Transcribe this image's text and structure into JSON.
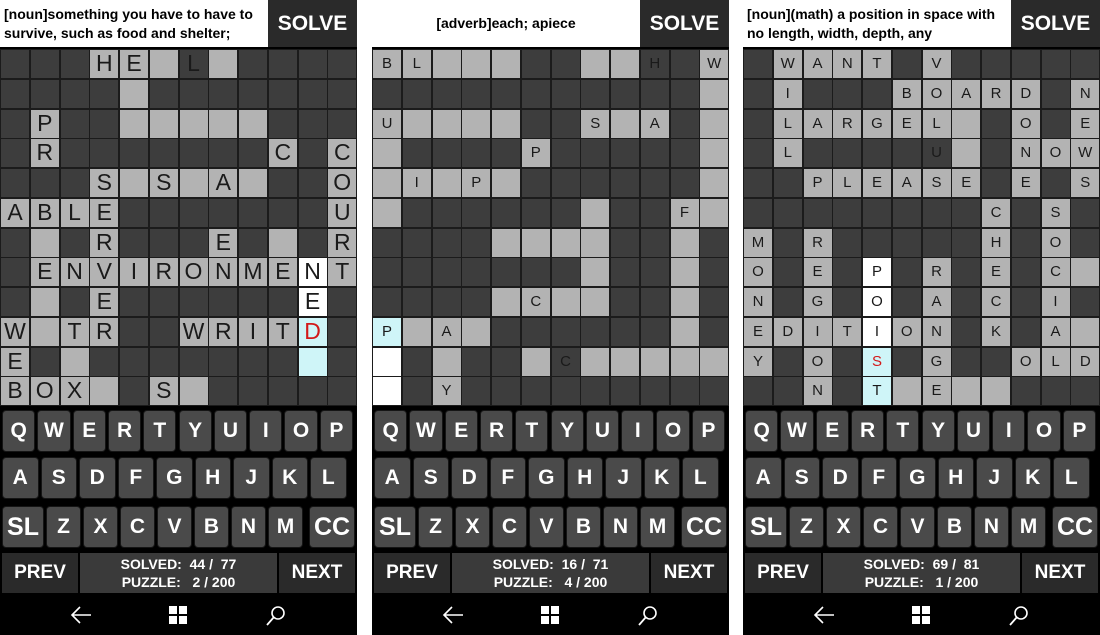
{
  "screens": [
    {
      "clue": "[noun]something you have to have to survive, such as food and shelter;",
      "solve_label": "SOLVE",
      "rows": [
        "DDDLLLDLDDDD",
        "DDDDLDDDDDDD",
        "DLDDLLLLLDDD",
        "DLDDDDDDDLDL",
        "DDDLLLLLLDDL",
        "LLLLDDDDDDDL",
        "DLDLDDDLDLDL",
        "DLLLLLLLLLWL",
        "DLDLDDDDDDWD",
        "LLLLDDLLLLCD",
        "LDLDDDDDDDCD",
        "LLLLDLLDDDDD"
      ],
      "letters": [
        {
          "r": 0,
          "c": 3,
          "t": "H"
        },
        {
          "r": 0,
          "c": 4,
          "t": "E"
        },
        {
          "r": 0,
          "c": 6,
          "t": "L"
        },
        {
          "r": 2,
          "c": 1,
          "t": "P"
        },
        {
          "r": 3,
          "c": 1,
          "t": "R"
        },
        {
          "r": 3,
          "c": 9,
          "t": "C"
        },
        {
          "r": 3,
          "c": 11,
          "t": "C"
        },
        {
          "r": 4,
          "c": 3,
          "t": "S"
        },
        {
          "r": 4,
          "c": 5,
          "t": "S"
        },
        {
          "r": 4,
          "c": 7,
          "t": "A"
        },
        {
          "r": 4,
          "c": 11,
          "t": "O"
        },
        {
          "r": 5,
          "c": 0,
          "t": "A"
        },
        {
          "r": 5,
          "c": 1,
          "t": "B"
        },
        {
          "r": 5,
          "c": 2,
          "t": "L"
        },
        {
          "r": 5,
          "c": 3,
          "t": "E"
        },
        {
          "r": 5,
          "c": 11,
          "t": "U"
        },
        {
          "r": 6,
          "c": 3,
          "t": "R"
        },
        {
          "r": 6,
          "c": 7,
          "t": "E"
        },
        {
          "r": 6,
          "c": 11,
          "t": "R"
        },
        {
          "r": 7,
          "c": 1,
          "t": "E"
        },
        {
          "r": 7,
          "c": 2,
          "t": "N"
        },
        {
          "r": 7,
          "c": 3,
          "t": "V"
        },
        {
          "r": 7,
          "c": 4,
          "t": "I"
        },
        {
          "r": 7,
          "c": 5,
          "t": "R"
        },
        {
          "r": 7,
          "c": 6,
          "t": "O"
        },
        {
          "r": 7,
          "c": 7,
          "t": "N"
        },
        {
          "r": 7,
          "c": 8,
          "t": "M"
        },
        {
          "r": 7,
          "c": 9,
          "t": "E"
        },
        {
          "r": 7,
          "c": 10,
          "t": "N"
        },
        {
          "r": 7,
          "c": 11,
          "t": "T"
        },
        {
          "r": 8,
          "c": 3,
          "t": "E"
        },
        {
          "r": 8,
          "c": 10,
          "t": "E"
        },
        {
          "r": 9,
          "c": 0,
          "t": "W"
        },
        {
          "r": 9,
          "c": 2,
          "t": "T"
        },
        {
          "r": 9,
          "c": 3,
          "t": "R"
        },
        {
          "r": 9,
          "c": 6,
          "t": "W"
        },
        {
          "r": 9,
          "c": 7,
          "t": "R"
        },
        {
          "r": 9,
          "c": 8,
          "t": "I"
        },
        {
          "r": 9,
          "c": 9,
          "t": "T"
        },
        {
          "r": 9,
          "c": 10,
          "t": "D",
          "red": true
        },
        {
          "r": 10,
          "c": 0,
          "t": "E"
        },
        {
          "r": 11,
          "c": 0,
          "t": "B"
        },
        {
          "r": 11,
          "c": 1,
          "t": "O"
        },
        {
          "r": 11,
          "c": 2,
          "t": "X"
        },
        {
          "r": 11,
          "c": 5,
          "t": "S"
        }
      ],
      "keys": [
        "Q",
        "W",
        "E",
        "R",
        "T",
        "Y",
        "U",
        "I",
        "O",
        "P",
        "A",
        "S",
        "D",
        "F",
        "G",
        "H",
        "J",
        "K",
        "L",
        "SL",
        "Z",
        "X",
        "C",
        "V",
        "B",
        "N",
        "M",
        "CC"
      ],
      "prev_label": "PREV",
      "next_label": "NEXT",
      "solved_line": "SOLVED:  44 /  77",
      "puzzle_line": "PUZZLE:   2 / 200"
    },
    {
      "clue": "[adverb]each; apiece",
      "solve_label": "SOLVE",
      "rows": [
        "LLLLLDDLLDDL",
        "DDDDDDDDDDDL",
        "LLLLLDDLLLDL",
        "LDDDDLDDDDDL",
        "LLLLLDDDDDDL",
        "LDDDDDDLDDLL",
        "DDDDLLLLDDLD",
        "DDDDDDDLDDLD",
        "DDDDLLLLDDLD",
        "CLLLDDDDDDLD",
        "WDLDDLDLLLLL",
        "WDLDDDDDDDDD"
      ],
      "letters": [
        {
          "r": 0,
          "c": 0,
          "t": "B"
        },
        {
          "r": 0,
          "c": 1,
          "t": "L"
        },
        {
          "r": 0,
          "c": 9,
          "t": "H"
        },
        {
          "r": 0,
          "c": 11,
          "t": "W"
        },
        {
          "r": 2,
          "c": 0,
          "t": "U"
        },
        {
          "r": 2,
          "c": 7,
          "t": "S"
        },
        {
          "r": 2,
          "c": 9,
          "t": "A"
        },
        {
          "r": 3,
          "c": 5,
          "t": "P"
        },
        {
          "r": 4,
          "c": 1,
          "t": "I"
        },
        {
          "r": 4,
          "c": 3,
          "t": "P"
        },
        {
          "r": 5,
          "c": 10,
          "t": "F"
        },
        {
          "r": 8,
          "c": 5,
          "t": "C"
        },
        {
          "r": 9,
          "c": 0,
          "t": "P"
        },
        {
          "r": 9,
          "c": 2,
          "t": "A"
        },
        {
          "r": 10,
          "c": 6,
          "t": "C"
        },
        {
          "r": 11,
          "c": 2,
          "t": "Y"
        }
      ],
      "keys": [
        "Q",
        "W",
        "E",
        "R",
        "T",
        "Y",
        "U",
        "I",
        "O",
        "P",
        "A",
        "S",
        "D",
        "F",
        "G",
        "H",
        "J",
        "K",
        "L",
        "SL",
        "Z",
        "X",
        "C",
        "V",
        "B",
        "N",
        "M",
        "CC"
      ],
      "prev_label": "PREV",
      "next_label": "NEXT",
      "solved_line": "SOLVED:  16 /  71",
      "puzzle_line": "PUZZLE:   4 / 200"
    },
    {
      "clue": "[noun](math) a position in space with no length, width, depth, any",
      "solve_label": "SOLVE",
      "rows": [
        "DLLLLDLDDDDD",
        "DLDDDLLLLLDL",
        "DLLLLLLLDLDL",
        "DLDDDDDLDLLL",
        "DDLLLLLLDLDL",
        "DDDDDDDDLDLD",
        "LDLDDDDDLDLD",
        "LDLDWDLDLDLL",
        "LDLDWDLDLDLD",
        "LLLLWLLDLDLL",
        "LDLDCDLDDLLL",
        "DDLDCLLLLDDD"
      ],
      "letters": [
        {
          "r": 0,
          "c": 1,
          "t": "W"
        },
        {
          "r": 0,
          "c": 2,
          "t": "A"
        },
        {
          "r": 0,
          "c": 3,
          "t": "N"
        },
        {
          "r": 0,
          "c": 4,
          "t": "T"
        },
        {
          "r": 0,
          "c": 6,
          "t": "V"
        },
        {
          "r": 1,
          "c": 1,
          "t": "I"
        },
        {
          "r": 1,
          "c": 5,
          "t": "B"
        },
        {
          "r": 1,
          "c": 6,
          "t": "O"
        },
        {
          "r": 1,
          "c": 7,
          "t": "A"
        },
        {
          "r": 1,
          "c": 8,
          "t": "R"
        },
        {
          "r": 1,
          "c": 9,
          "t": "D"
        },
        {
          "r": 1,
          "c": 11,
          "t": "N"
        },
        {
          "r": 2,
          "c": 1,
          "t": "L"
        },
        {
          "r": 2,
          "c": 2,
          "t": "A"
        },
        {
          "r": 2,
          "c": 3,
          "t": "R"
        },
        {
          "r": 2,
          "c": 4,
          "t": "G"
        },
        {
          "r": 2,
          "c": 5,
          "t": "E"
        },
        {
          "r": 2,
          "c": 6,
          "t": "L"
        },
        {
          "r": 2,
          "c": 9,
          "t": "O"
        },
        {
          "r": 2,
          "c": 11,
          "t": "E"
        },
        {
          "r": 3,
          "c": 1,
          "t": "L"
        },
        {
          "r": 3,
          "c": 6,
          "t": "U"
        },
        {
          "r": 3,
          "c": 9,
          "t": "N"
        },
        {
          "r": 3,
          "c": 10,
          "t": "O"
        },
        {
          "r": 3,
          "c": 11,
          "t": "W"
        },
        {
          "r": 4,
          "c": 2,
          "t": "P"
        },
        {
          "r": 4,
          "c": 3,
          "t": "L"
        },
        {
          "r": 4,
          "c": 4,
          "t": "E"
        },
        {
          "r": 4,
          "c": 5,
          "t": "A"
        },
        {
          "r": 4,
          "c": 6,
          "t": "S"
        },
        {
          "r": 4,
          "c": 7,
          "t": "E"
        },
        {
          "r": 4,
          "c": 9,
          "t": "E"
        },
        {
          "r": 4,
          "c": 11,
          "t": "S"
        },
        {
          "r": 5,
          "c": 8,
          "t": "C"
        },
        {
          "r": 5,
          "c": 10,
          "t": "S"
        },
        {
          "r": 6,
          "c": 0,
          "t": "M"
        },
        {
          "r": 6,
          "c": 2,
          "t": "R"
        },
        {
          "r": 6,
          "c": 8,
          "t": "H"
        },
        {
          "r": 6,
          "c": 10,
          "t": "O"
        },
        {
          "r": 7,
          "c": 0,
          "t": "O"
        },
        {
          "r": 7,
          "c": 2,
          "t": "E"
        },
        {
          "r": 7,
          "c": 4,
          "t": "P"
        },
        {
          "r": 7,
          "c": 6,
          "t": "R"
        },
        {
          "r": 7,
          "c": 8,
          "t": "E"
        },
        {
          "r": 7,
          "c": 10,
          "t": "C"
        },
        {
          "r": 8,
          "c": 0,
          "t": "N"
        },
        {
          "r": 8,
          "c": 2,
          "t": "G"
        },
        {
          "r": 8,
          "c": 4,
          "t": "O"
        },
        {
          "r": 8,
          "c": 6,
          "t": "A"
        },
        {
          "r": 8,
          "c": 8,
          "t": "C"
        },
        {
          "r": 8,
          "c": 10,
          "t": "I"
        },
        {
          "r": 9,
          "c": 0,
          "t": "E"
        },
        {
          "r": 9,
          "c": 1,
          "t": "D"
        },
        {
          "r": 9,
          "c": 2,
          "t": "I"
        },
        {
          "r": 9,
          "c": 3,
          "t": "T"
        },
        {
          "r": 9,
          "c": 4,
          "t": "I"
        },
        {
          "r": 9,
          "c": 5,
          "t": "O"
        },
        {
          "r": 9,
          "c": 6,
          "t": "N"
        },
        {
          "r": 9,
          "c": 8,
          "t": "K"
        },
        {
          "r": 9,
          "c": 10,
          "t": "A"
        },
        {
          "r": 10,
          "c": 0,
          "t": "Y"
        },
        {
          "r": 10,
          "c": 2,
          "t": "O"
        },
        {
          "r": 10,
          "c": 4,
          "t": "S",
          "red": true
        },
        {
          "r": 10,
          "c": 6,
          "t": "G"
        },
        {
          "r": 10,
          "c": 9,
          "t": "O"
        },
        {
          "r": 10,
          "c": 10,
          "t": "L"
        },
        {
          "r": 10,
          "c": 11,
          "t": "D"
        },
        {
          "r": 11,
          "c": 2,
          "t": "N"
        },
        {
          "r": 11,
          "c": 4,
          "t": "T"
        },
        {
          "r": 11,
          "c": 6,
          "t": "E"
        }
      ],
      "keys": [
        "Q",
        "W",
        "E",
        "R",
        "T",
        "Y",
        "U",
        "I",
        "O",
        "P",
        "A",
        "S",
        "D",
        "F",
        "G",
        "H",
        "J",
        "K",
        "L",
        "SL",
        "Z",
        "X",
        "C",
        "V",
        "B",
        "N",
        "M",
        "CC"
      ],
      "prev_label": "PREV",
      "next_label": "NEXT",
      "solved_line": "SOLVED:  69 /  81",
      "puzzle_line": "PUZZLE:   1 / 200"
    }
  ],
  "system_icons": [
    "back-arrow-icon",
    "windows-start-icon",
    "search-icon"
  ]
}
